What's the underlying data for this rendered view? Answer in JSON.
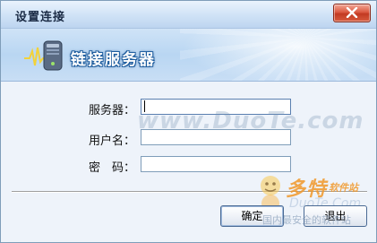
{
  "window": {
    "title": "设置连接"
  },
  "banner": {
    "title": "链接服务器",
    "icon": "server-icon"
  },
  "form": {
    "server_label": "服务器：",
    "server_value": "",
    "username_label": "用户名：",
    "username_value": "",
    "password_label": "密　码：",
    "password_value": ""
  },
  "buttons": {
    "ok_label": "确定",
    "exit_label": "退出"
  },
  "watermark": {
    "text": "www.DuoTe.com",
    "brand": "多特",
    "brand_sub": "软件站",
    "url": "DuoTe.Com",
    "tagline": "国内最安全的软件站"
  },
  "colors": {
    "accent": "#1d5c9e",
    "close_button": "#dc5a42"
  }
}
